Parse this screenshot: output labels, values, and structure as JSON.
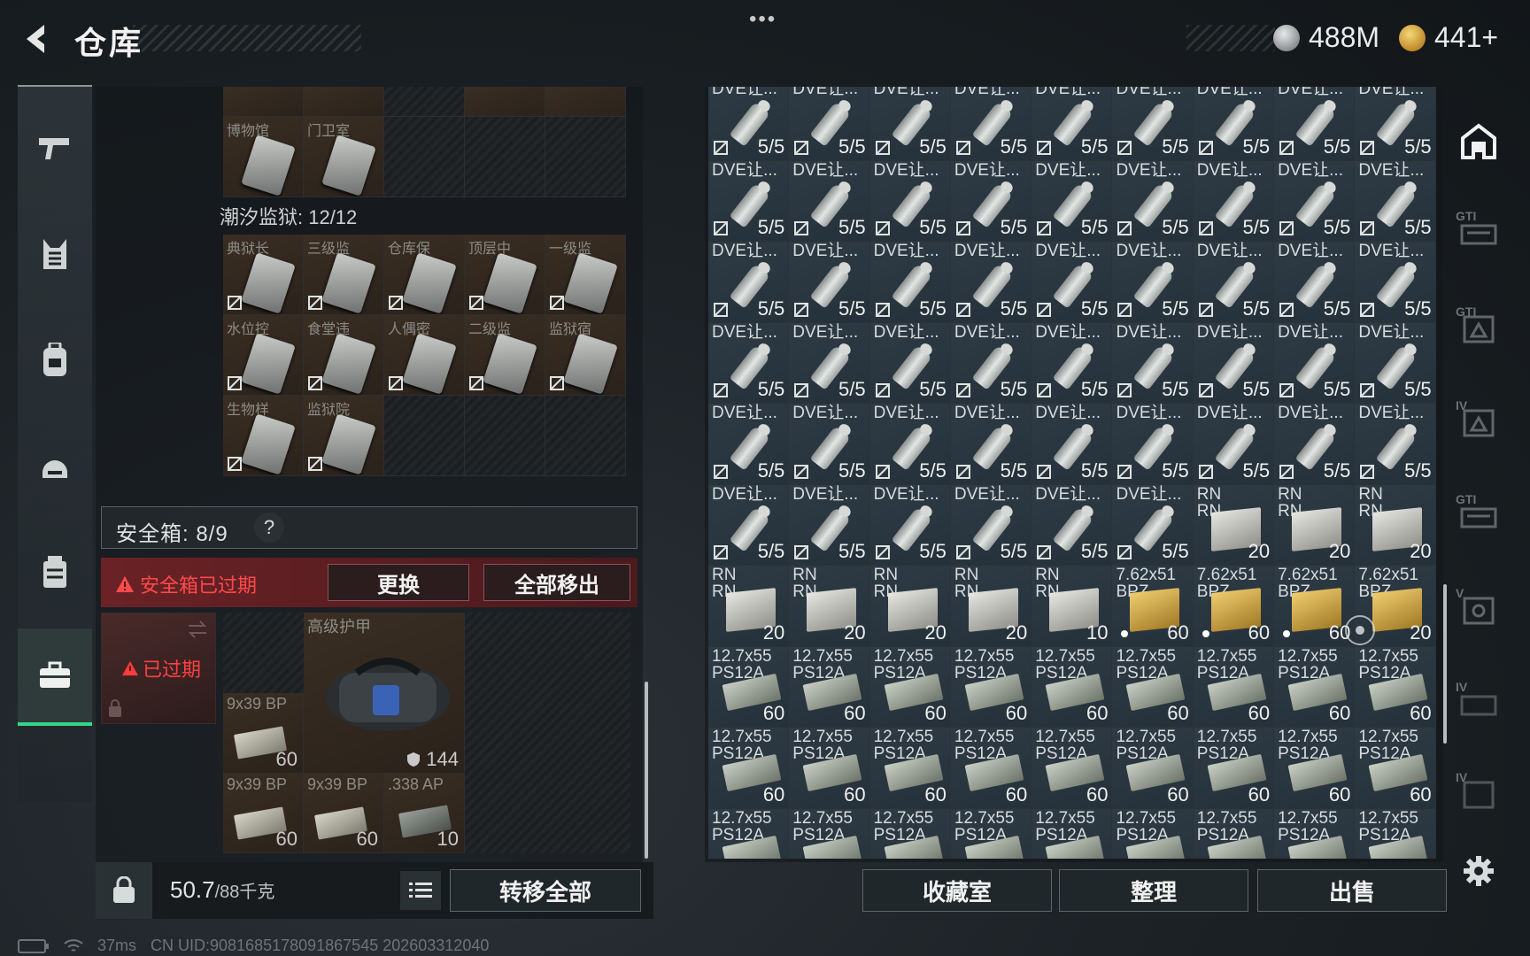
{
  "header": {
    "title": "仓库",
    "currency": [
      {
        "icon": "silver-coin-icon",
        "value": "488M"
      },
      {
        "icon": "gold-coin-icon",
        "value": "441+"
      }
    ],
    "more": "•••"
  },
  "sidebar": {
    "items": [
      {
        "icon": "gun-icon",
        "active": false
      },
      {
        "icon": "armor-vest-icon",
        "active": false
      },
      {
        "icon": "backpack-icon",
        "active": false
      },
      {
        "icon": "helmet-icon",
        "active": false
      },
      {
        "icon": "chest-rig-icon",
        "active": false
      },
      {
        "icon": "briefcase-icon",
        "active": true
      }
    ]
  },
  "left": {
    "top_items": [
      {
        "name": "博物馆"
      },
      {
        "name": "门卫室"
      }
    ],
    "section_label": "潮汐监狱: 12/12",
    "prison_items": [
      {
        "name": "典狱长"
      },
      {
        "name": "三级监"
      },
      {
        "name": "仓库保"
      },
      {
        "name": "顶层中"
      },
      {
        "name": "一级监"
      },
      {
        "name": "水位控"
      },
      {
        "name": "食堂违"
      },
      {
        "name": "人偶密"
      },
      {
        "name": "二级监"
      },
      {
        "name": "监狱宿"
      },
      {
        "name": "生物样"
      },
      {
        "name": "监狱院"
      }
    ],
    "safebox_label": "安全箱: 8/9",
    "help": "?",
    "expired_warning": "安全箱已过期",
    "replace_btn": "更换",
    "remove_all_btn": "全部移出",
    "expired_tag": "已过期",
    "bag": {
      "armor_name": "高级护甲",
      "armor_durability": "144",
      "items": [
        {
          "name": "9x39 BP",
          "qty": "60"
        },
        {
          "name": "9x39 BP",
          "qty": "60"
        },
        {
          "name": "9x39 BP",
          "qty": "60"
        },
        {
          "name": ".338 AP",
          "qty": "10"
        }
      ]
    },
    "weight_value": "50.7",
    "weight_cap": "/88千克",
    "transfer_all_btn": "转移全部"
  },
  "stash": {
    "rows": [
      {
        "type": "tube",
        "name": "DVE让...",
        "qty": "5/5",
        "count": 9
      },
      {
        "type": "tube",
        "name": "DVE让...",
        "qty": "5/5",
        "count": 9
      },
      {
        "type": "tube",
        "name": "DVE让...",
        "qty": "5/5",
        "count": 9
      },
      {
        "type": "tube",
        "name": "DVE让...",
        "qty": "5/5",
        "count": 9
      },
      {
        "type": "tube",
        "name": "DVE让...",
        "qty": "5/5",
        "count": 9
      }
    ],
    "mixed_row_6": [
      {
        "type": "tube",
        "name": "DVE让...",
        "qty": "5/5"
      },
      {
        "type": "tube",
        "name": "DVE让...",
        "qty": "5/5"
      },
      {
        "type": "tube",
        "name": "DVE让...",
        "qty": "5/5"
      },
      {
        "type": "tube",
        "name": "DVE让...",
        "qty": "5/5"
      },
      {
        "type": "tube",
        "name": "DVE让...",
        "qty": "5/5"
      },
      {
        "type": "tube",
        "name": "DVE让...",
        "qty": "5/5"
      },
      {
        "type": "box",
        "name": "RN\nRN",
        "qty": "20"
      },
      {
        "type": "box",
        "name": "RN\nRN",
        "qty": "20"
      },
      {
        "type": "box",
        "name": "RN\nRN",
        "qty": "20"
      }
    ],
    "mixed_row_7": [
      {
        "type": "box",
        "name": "RN\nRN",
        "qty": "20"
      },
      {
        "type": "box",
        "name": "RN\nRN",
        "qty": "20"
      },
      {
        "type": "box",
        "name": "RN\nRN",
        "qty": "20"
      },
      {
        "type": "box",
        "name": "RN\nRN",
        "qty": "20"
      },
      {
        "type": "box",
        "name": "RN\nRN",
        "qty": "10"
      },
      {
        "type": "gold",
        "name": "7.62x51\nBPZ",
        "qty": "60",
        "dot": true
      },
      {
        "type": "gold",
        "name": "7.62x51\nBPZ",
        "qty": "60",
        "dot": true
      },
      {
        "type": "gold",
        "name": "7.62x51\nBPZ",
        "qty": "60",
        "dot": true
      },
      {
        "type": "gold",
        "name": "7.62x51\nBPZ",
        "qty": "20"
      }
    ],
    "ammo_rows": [
      {
        "type": "green",
        "name": "12.7x55\nPS12A",
        "qty": "60",
        "count": 9
      },
      {
        "type": "green",
        "name": "12.7x55\nPS12A",
        "qty": "60",
        "count": 9
      },
      {
        "type": "green",
        "name": "12.7x55\nPS12A",
        "qty": "",
        "count": 9
      }
    ],
    "buttons": {
      "collection": "收藏室",
      "sort": "整理",
      "sell": "出售"
    }
  },
  "right_rail": [
    {
      "icon": "stash-home-icon",
      "label": ""
    },
    {
      "icon": "weapon-case-icon",
      "label": "GTI"
    },
    {
      "icon": "item-case-icon",
      "label": "GTI"
    },
    {
      "icon": "item-case-icon",
      "label": "IV"
    },
    {
      "icon": "weapon-case-icon",
      "label": "GTI"
    },
    {
      "icon": "item-case-icon",
      "label": "V"
    },
    {
      "icon": "weapon-case-icon",
      "label": "IV"
    },
    {
      "icon": "item-case-icon",
      "label": "IV"
    }
  ],
  "status": {
    "ping": "37ms",
    "uid": "CN UID:9081685178091867545 202603312040"
  },
  "colors": {
    "accent": "#33d68a",
    "danger": "#ff4a4a"
  }
}
